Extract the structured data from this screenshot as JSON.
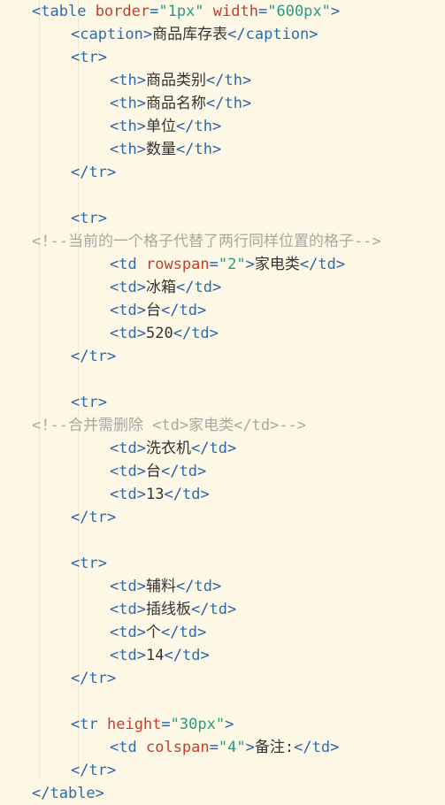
{
  "lines": [
    {
      "indent": 0,
      "tokens": [
        {
          "k": "b",
          "s": "<"
        },
        {
          "k": "t",
          "s": "table"
        },
        {
          "k": "x",
          "s": " "
        },
        {
          "k": "a",
          "s": "border"
        },
        {
          "k": "b",
          "s": "="
        },
        {
          "k": "v",
          "s": "\"1px\""
        },
        {
          "k": "x",
          "s": " "
        },
        {
          "k": "a",
          "s": "width"
        },
        {
          "k": "b",
          "s": "="
        },
        {
          "k": "v",
          "s": "\"600px\""
        },
        {
          "k": "b",
          "s": ">"
        }
      ]
    },
    {
      "indent": 1,
      "tokens": [
        {
          "k": "b",
          "s": "<"
        },
        {
          "k": "t",
          "s": "caption"
        },
        {
          "k": "b",
          "s": ">"
        },
        {
          "k": "x",
          "s": "商品库存表"
        },
        {
          "k": "b",
          "s": "</"
        },
        {
          "k": "t",
          "s": "caption"
        },
        {
          "k": "b",
          "s": ">"
        }
      ]
    },
    {
      "indent": 1,
      "tokens": [
        {
          "k": "b",
          "s": "<"
        },
        {
          "k": "t",
          "s": "tr"
        },
        {
          "k": "b",
          "s": ">"
        }
      ]
    },
    {
      "indent": 2,
      "tokens": [
        {
          "k": "b",
          "s": "<"
        },
        {
          "k": "t",
          "s": "th"
        },
        {
          "k": "b",
          "s": ">"
        },
        {
          "k": "x",
          "s": "商品类别"
        },
        {
          "k": "b",
          "s": "</"
        },
        {
          "k": "t",
          "s": "th"
        },
        {
          "k": "b",
          "s": ">"
        }
      ]
    },
    {
      "indent": 2,
      "tokens": [
        {
          "k": "b",
          "s": "<"
        },
        {
          "k": "t",
          "s": "th"
        },
        {
          "k": "b",
          "s": ">"
        },
        {
          "k": "x",
          "s": "商品名称"
        },
        {
          "k": "b",
          "s": "</"
        },
        {
          "k": "t",
          "s": "th"
        },
        {
          "k": "b",
          "s": ">"
        }
      ]
    },
    {
      "indent": 2,
      "tokens": [
        {
          "k": "b",
          "s": "<"
        },
        {
          "k": "t",
          "s": "th"
        },
        {
          "k": "b",
          "s": ">"
        },
        {
          "k": "x",
          "s": "单位"
        },
        {
          "k": "b",
          "s": "</"
        },
        {
          "k": "t",
          "s": "th"
        },
        {
          "k": "b",
          "s": ">"
        }
      ]
    },
    {
      "indent": 2,
      "tokens": [
        {
          "k": "b",
          "s": "<"
        },
        {
          "k": "t",
          "s": "th"
        },
        {
          "k": "b",
          "s": ">"
        },
        {
          "k": "x",
          "s": "数量"
        },
        {
          "k": "b",
          "s": "</"
        },
        {
          "k": "t",
          "s": "th"
        },
        {
          "k": "b",
          "s": ">"
        }
      ]
    },
    {
      "indent": 1,
      "tokens": [
        {
          "k": "b",
          "s": "</"
        },
        {
          "k": "t",
          "s": "tr"
        },
        {
          "k": "b",
          "s": ">"
        }
      ]
    },
    {
      "indent": 0,
      "tokens": []
    },
    {
      "indent": 1,
      "tokens": [
        {
          "k": "b",
          "s": "<"
        },
        {
          "k": "t",
          "s": "tr"
        },
        {
          "k": "b",
          "s": ">"
        }
      ]
    },
    {
      "indent": 0,
      "tokens": [
        {
          "k": "c",
          "s": "<!--当前的一个格子代替了两行同样位置的格子-->"
        }
      ]
    },
    {
      "indent": 2,
      "tokens": [
        {
          "k": "b",
          "s": "<"
        },
        {
          "k": "t",
          "s": "td"
        },
        {
          "k": "x",
          "s": " "
        },
        {
          "k": "a",
          "s": "rowspan"
        },
        {
          "k": "b",
          "s": "="
        },
        {
          "k": "v",
          "s": "\"2\""
        },
        {
          "k": "b",
          "s": ">"
        },
        {
          "k": "x",
          "s": "家电类"
        },
        {
          "k": "b",
          "s": "</"
        },
        {
          "k": "t",
          "s": "td"
        },
        {
          "k": "b",
          "s": ">"
        }
      ]
    },
    {
      "indent": 2,
      "tokens": [
        {
          "k": "b",
          "s": "<"
        },
        {
          "k": "t",
          "s": "td"
        },
        {
          "k": "b",
          "s": ">"
        },
        {
          "k": "x",
          "s": "冰箱"
        },
        {
          "k": "b",
          "s": "</"
        },
        {
          "k": "t",
          "s": "td"
        },
        {
          "k": "b",
          "s": ">"
        }
      ]
    },
    {
      "indent": 2,
      "tokens": [
        {
          "k": "b",
          "s": "<"
        },
        {
          "k": "t",
          "s": "td"
        },
        {
          "k": "b",
          "s": ">"
        },
        {
          "k": "x",
          "s": "台"
        },
        {
          "k": "b",
          "s": "</"
        },
        {
          "k": "t",
          "s": "td"
        },
        {
          "k": "b",
          "s": ">"
        }
      ]
    },
    {
      "indent": 2,
      "tokens": [
        {
          "k": "b",
          "s": "<"
        },
        {
          "k": "t",
          "s": "td"
        },
        {
          "k": "b",
          "s": ">"
        },
        {
          "k": "x",
          "s": "520"
        },
        {
          "k": "b",
          "s": "</"
        },
        {
          "k": "t",
          "s": "td"
        },
        {
          "k": "b",
          "s": ">"
        }
      ]
    },
    {
      "indent": 1,
      "tokens": [
        {
          "k": "b",
          "s": "</"
        },
        {
          "k": "t",
          "s": "tr"
        },
        {
          "k": "b",
          "s": ">"
        }
      ]
    },
    {
      "indent": 0,
      "tokens": []
    },
    {
      "indent": 1,
      "tokens": [
        {
          "k": "b",
          "s": "<"
        },
        {
          "k": "t",
          "s": "tr"
        },
        {
          "k": "b",
          "s": ">"
        }
      ]
    },
    {
      "indent": 0,
      "tokens": [
        {
          "k": "c",
          "s": "<!--合并需删除 <td>家电类</td>-->"
        }
      ]
    },
    {
      "indent": 2,
      "tokens": [
        {
          "k": "b",
          "s": "<"
        },
        {
          "k": "t",
          "s": "td"
        },
        {
          "k": "b",
          "s": ">"
        },
        {
          "k": "x",
          "s": "洗衣机"
        },
        {
          "k": "b",
          "s": "</"
        },
        {
          "k": "t",
          "s": "td"
        },
        {
          "k": "b",
          "s": ">"
        }
      ]
    },
    {
      "indent": 2,
      "tokens": [
        {
          "k": "b",
          "s": "<"
        },
        {
          "k": "t",
          "s": "td"
        },
        {
          "k": "b",
          "s": ">"
        },
        {
          "k": "x",
          "s": "台"
        },
        {
          "k": "b",
          "s": "</"
        },
        {
          "k": "t",
          "s": "td"
        },
        {
          "k": "b",
          "s": ">"
        }
      ]
    },
    {
      "indent": 2,
      "tokens": [
        {
          "k": "b",
          "s": "<"
        },
        {
          "k": "t",
          "s": "td"
        },
        {
          "k": "b",
          "s": ">"
        },
        {
          "k": "x",
          "s": "13"
        },
        {
          "k": "b",
          "s": "</"
        },
        {
          "k": "t",
          "s": "td"
        },
        {
          "k": "b",
          "s": ">"
        }
      ]
    },
    {
      "indent": 1,
      "tokens": [
        {
          "k": "b",
          "s": "</"
        },
        {
          "k": "t",
          "s": "tr"
        },
        {
          "k": "b",
          "s": ">"
        }
      ]
    },
    {
      "indent": 0,
      "tokens": []
    },
    {
      "indent": 1,
      "tokens": [
        {
          "k": "b",
          "s": "<"
        },
        {
          "k": "t",
          "s": "tr"
        },
        {
          "k": "b",
          "s": ">"
        }
      ]
    },
    {
      "indent": 2,
      "tokens": [
        {
          "k": "b",
          "s": "<"
        },
        {
          "k": "t",
          "s": "td"
        },
        {
          "k": "b",
          "s": ">"
        },
        {
          "k": "x",
          "s": "辅料"
        },
        {
          "k": "b",
          "s": "</"
        },
        {
          "k": "t",
          "s": "td"
        },
        {
          "k": "b",
          "s": ">"
        }
      ]
    },
    {
      "indent": 2,
      "tokens": [
        {
          "k": "b",
          "s": "<"
        },
        {
          "k": "t",
          "s": "td"
        },
        {
          "k": "b",
          "s": ">"
        },
        {
          "k": "x",
          "s": "插线板"
        },
        {
          "k": "b",
          "s": "</"
        },
        {
          "k": "t",
          "s": "td"
        },
        {
          "k": "b",
          "s": ">"
        }
      ]
    },
    {
      "indent": 2,
      "tokens": [
        {
          "k": "b",
          "s": "<"
        },
        {
          "k": "t",
          "s": "td"
        },
        {
          "k": "b",
          "s": ">"
        },
        {
          "k": "x",
          "s": "个"
        },
        {
          "k": "b",
          "s": "</"
        },
        {
          "k": "t",
          "s": "td"
        },
        {
          "k": "b",
          "s": ">"
        }
      ]
    },
    {
      "indent": 2,
      "tokens": [
        {
          "k": "b",
          "s": "<"
        },
        {
          "k": "t",
          "s": "td"
        },
        {
          "k": "b",
          "s": ">"
        },
        {
          "k": "x",
          "s": "14"
        },
        {
          "k": "b",
          "s": "</"
        },
        {
          "k": "t",
          "s": "td"
        },
        {
          "k": "b",
          "s": ">"
        }
      ]
    },
    {
      "indent": 1,
      "tokens": [
        {
          "k": "b",
          "s": "</"
        },
        {
          "k": "t",
          "s": "tr"
        },
        {
          "k": "b",
          "s": ">"
        }
      ]
    },
    {
      "indent": 0,
      "tokens": []
    },
    {
      "indent": 1,
      "tokens": [
        {
          "k": "b",
          "s": "<"
        },
        {
          "k": "t",
          "s": "tr"
        },
        {
          "k": "x",
          "s": " "
        },
        {
          "k": "a",
          "s": "height"
        },
        {
          "k": "b",
          "s": "="
        },
        {
          "k": "v",
          "s": "\"30px\""
        },
        {
          "k": "b",
          "s": ">"
        }
      ]
    },
    {
      "indent": 2,
      "tokens": [
        {
          "k": "b",
          "s": "<"
        },
        {
          "k": "t",
          "s": "td"
        },
        {
          "k": "x",
          "s": " "
        },
        {
          "k": "a",
          "s": "colspan"
        },
        {
          "k": "b",
          "s": "="
        },
        {
          "k": "v",
          "s": "\"4\""
        },
        {
          "k": "b",
          "s": ">"
        },
        {
          "k": "x",
          "s": "备注:"
        },
        {
          "k": "b",
          "s": "</"
        },
        {
          "k": "t",
          "s": "td"
        },
        {
          "k": "b",
          "s": ">"
        }
      ]
    },
    {
      "indent": 1,
      "tokens": [
        {
          "k": "b",
          "s": "</"
        },
        {
          "k": "t",
          "s": "tr"
        },
        {
          "k": "b",
          "s": ">"
        }
      ]
    },
    {
      "indent": 0,
      "tokens": [
        {
          "k": "b",
          "s": "</"
        },
        {
          "k": "t",
          "s": "table"
        },
        {
          "k": "b",
          "s": ">"
        }
      ]
    }
  ]
}
